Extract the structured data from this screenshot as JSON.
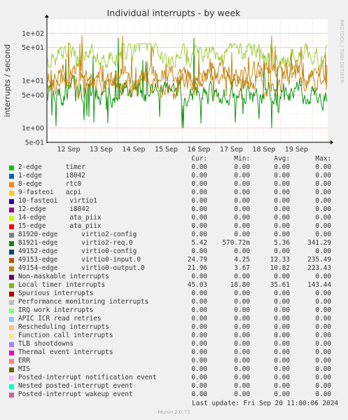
{
  "chart_data": {
    "type": "line",
    "title": "Individual interrupts - by week",
    "ylabel": "interrupts / second",
    "yscale": "log",
    "ylim": [
      0.5,
      200
    ],
    "ytick_labels": [
      "1e+02",
      "5e+01",
      "1e+01",
      "5e+00",
      "1e+00",
      "5e-01"
    ],
    "xtick_labels": [
      "12 Sep",
      "13 Sep",
      "14 Sep",
      "15 Sep",
      "16 Sep",
      "17 Sep",
      "18 Sep",
      "19 Sep"
    ],
    "x_start": "2024-09-11T20:00",
    "x_end": "2024-09-20T11:00",
    "grid": true,
    "side_label": "RRDTOOL / TOBI OETIKER",
    "series": [
      {
        "name": "81921-edge virtio2-req.0",
        "color": "#008f00",
        "approx_range": [
          1.0,
          90
        ],
        "typical": 5.4
      },
      {
        "name": "49153-edge virtio0-input.0",
        "color": "#cc7a00",
        "approx_range": [
          4.5,
          90
        ],
        "typical": 12.3
      },
      {
        "name": "49154-edge virtio0-output.0",
        "color": "#b8860b",
        "approx_range": [
          4.0,
          60
        ],
        "typical": 10.8
      },
      {
        "name": "Local timer interrupts",
        "color": "#9acd32",
        "approx_range": [
          19,
          60
        ],
        "typical": 35.6
      }
    ]
  },
  "legend": {
    "headers": [
      "Cur:",
      "Min:",
      "Avg:",
      "Max:"
    ],
    "rows": [
      {
        "name": "2-edge      timer",
        "color": "#00cc00",
        "cur": "0.00",
        "min": "0.00",
        "avg": "0.00",
        "max": "0.00"
      },
      {
        "name": "1-edge      i8042",
        "color": "#0066b3",
        "cur": "0.00",
        "min": "0.00",
        "avg": "0.00",
        "max": "0.00"
      },
      {
        "name": "8-edge      rtc0",
        "color": "#ff8000",
        "cur": "0.00",
        "min": "0.00",
        "avg": "0.00",
        "max": "0.00"
      },
      {
        "name": "9-fasteoi   acpi",
        "color": "#ffcc00",
        "cur": "0.00",
        "min": "0.00",
        "avg": "0.00",
        "max": "0.00"
      },
      {
        "name": "10-fasteoi   virtio1",
        "color": "#330099",
        "cur": "0.00",
        "min": "0.00",
        "avg": "0.00",
        "max": "0.00"
      },
      {
        "name": "12-edge      i8042",
        "color": "#990099",
        "cur": "0.00",
        "min": "0.00",
        "avg": "0.00",
        "max": "0.00"
      },
      {
        "name": "14-edge      ata_piix",
        "color": "#ccff00",
        "cur": "0.00",
        "min": "0.00",
        "avg": "0.00",
        "max": "0.00"
      },
      {
        "name": "15-edge      ata_piix",
        "color": "#ff0000",
        "cur": "0.00",
        "min": "0.00",
        "avg": "0.00",
        "max": "0.00"
      },
      {
        "name": "81920-edge      virtio2-config",
        "color": "#808080",
        "cur": "0.00",
        "min": "0.00",
        "avg": "0.00",
        "max": "0.00"
      },
      {
        "name": "81921-edge      virtio2-req.0",
        "color": "#008f00",
        "cur": "5.42",
        "min": "570.72m",
        "avg": "5.36",
        "max": "341.29"
      },
      {
        "name": "49152-edge      virtio0-config",
        "color": "#00487d",
        "cur": "0.00",
        "min": "0.00",
        "avg": "0.00",
        "max": "0.00"
      },
      {
        "name": "49153-edge      virtio0-input.0",
        "color": "#b35a00",
        "cur": "24.79",
        "min": "4.25",
        "avg": "12.33",
        "max": "235.49"
      },
      {
        "name": "49154-edge      virtio0-output.0",
        "color": "#b38f00",
        "cur": "21.96",
        "min": "3.67",
        "avg": "10.82",
        "max": "223.43"
      },
      {
        "name": "Non-maskable interrupts",
        "color": "#6b006b",
        "cur": "0.00",
        "min": "0.00",
        "avg": "0.00",
        "max": "0.00"
      },
      {
        "name": "Local timer interrupts",
        "color": "#8fb300",
        "cur": "45.03",
        "min": "18.80",
        "avg": "35.61",
        "max": "143.44"
      },
      {
        "name": "Spurious interrupts",
        "color": "#b30000",
        "cur": "0.00",
        "min": "0.00",
        "avg": "0.00",
        "max": "0.00"
      },
      {
        "name": "Performance monitoring interrupts",
        "color": "#bebebe",
        "cur": "0.00",
        "min": "0.00",
        "avg": "0.00",
        "max": "0.00"
      },
      {
        "name": "IRQ work interrupts",
        "color": "#80ff80",
        "cur": "0.00",
        "min": "0.00",
        "avg": "0.00",
        "max": "0.00"
      },
      {
        "name": "APIC ICR read retries",
        "color": "#80c9ff",
        "cur": "0.00",
        "min": "0.00",
        "avg": "0.00",
        "max": "0.00"
      },
      {
        "name": "Rescheduling interrupts",
        "color": "#ffc080",
        "cur": "0.00",
        "min": "0.00",
        "avg": "0.00",
        "max": "0.00"
      },
      {
        "name": "Function call interrupts",
        "color": "#ffe680",
        "cur": "0.00",
        "min": "0.00",
        "avg": "0.00",
        "max": "0.00"
      },
      {
        "name": "TLB shootdowns",
        "color": "#aa80ff",
        "cur": "0.00",
        "min": "0.00",
        "avg": "0.00",
        "max": "0.00"
      },
      {
        "name": "Thermal event interrupts",
        "color": "#ee00cc",
        "cur": "0.00",
        "min": "0.00",
        "avg": "0.00",
        "max": "0.00"
      },
      {
        "name": "ERR",
        "color": "#ff8080",
        "cur": "0.00",
        "min": "0.00",
        "avg": "0.00",
        "max": "0.00"
      },
      {
        "name": "MIS",
        "color": "#666600",
        "cur": "0.00",
        "min": "0.00",
        "avg": "0.00",
        "max": "0.00"
      },
      {
        "name": "Posted-interrupt notification event",
        "color": "#ffbfff",
        "cur": "0.00",
        "min": "0.00",
        "avg": "0.00",
        "max": "0.00"
      },
      {
        "name": "Nested posted-interrupt event",
        "color": "#00ffcc",
        "cur": "0.00",
        "min": "0.00",
        "avg": "0.00",
        "max": "0.00"
      },
      {
        "name": "Posted-interrupt wakeup event",
        "color": "#cc6699",
        "cur": "0.00",
        "min": "0.00",
        "avg": "0.00",
        "max": "0.00"
      }
    ]
  },
  "footer": {
    "last_update": "Last update: Fri Sep 20 11:00:06 2024",
    "munin": "Munin 2.0.73"
  }
}
